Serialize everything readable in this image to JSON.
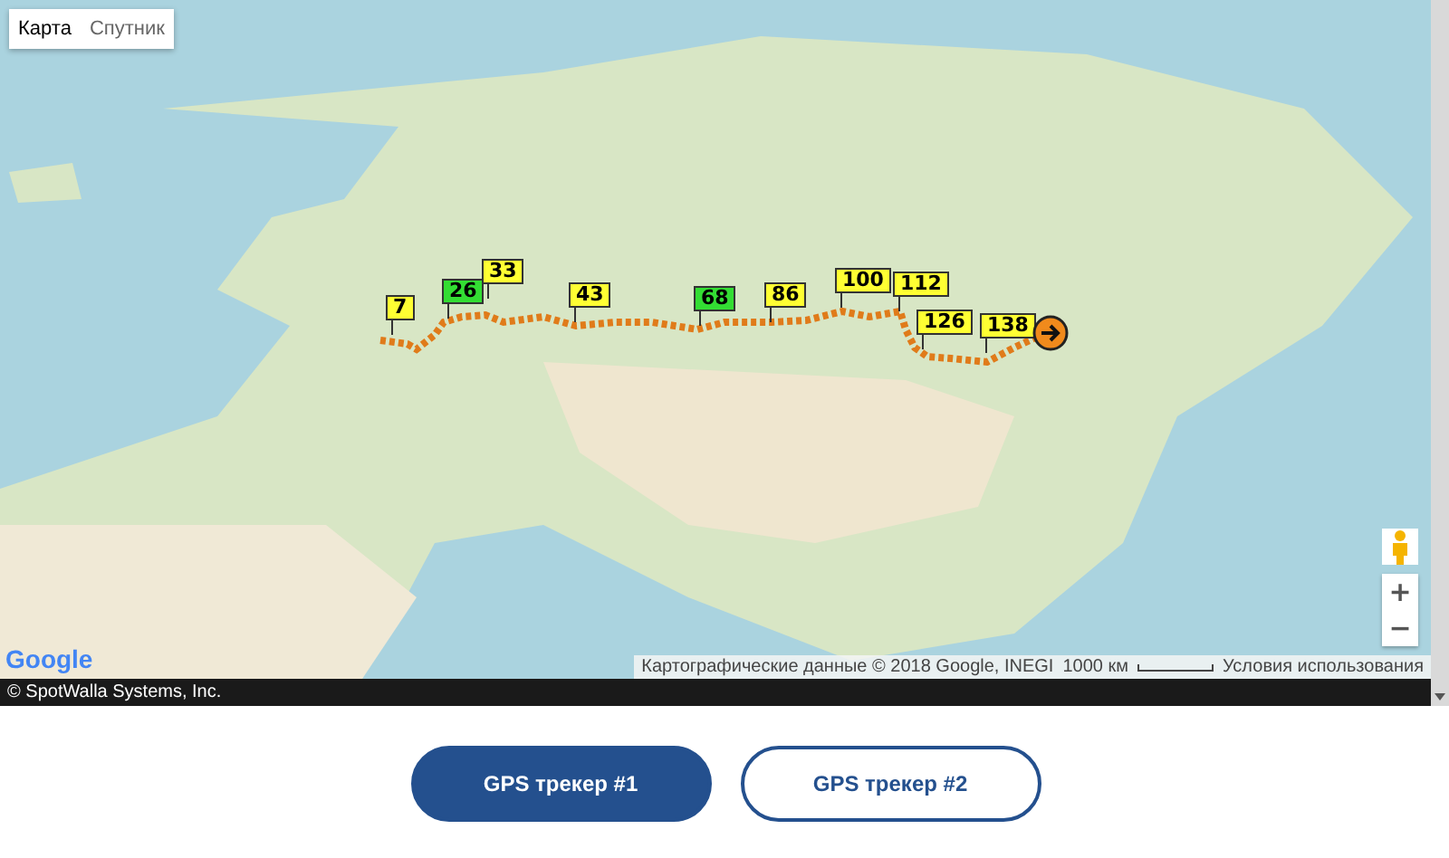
{
  "map": {
    "map_types": [
      {
        "label": "Карта",
        "selected": true
      },
      {
        "label": "Спутник",
        "selected": false
      }
    ],
    "markers": [
      {
        "label": "7",
        "color": "#ffff33"
      },
      {
        "label": "26",
        "color": "#33dd33"
      },
      {
        "label": "33",
        "color": "#ffff33"
      },
      {
        "label": "43",
        "color": "#ffff33"
      },
      {
        "label": "68",
        "color": "#33dd33"
      },
      {
        "label": "86",
        "color": "#ffff33"
      },
      {
        "label": "100",
        "color": "#ffff33"
      },
      {
        "label": "112",
        "color": "#ffff33"
      },
      {
        "label": "126",
        "color": "#ffff33"
      },
      {
        "label": "138",
        "color": "#ffff33"
      }
    ],
    "zoom_in": "+",
    "zoom_out": "−",
    "logo": "Google",
    "attribution": "Картографические данные © 2018 Google, INEGI",
    "scale": "1000 км",
    "terms": "Условия использования"
  },
  "copyright": "© SpotWalla Systems, Inc.",
  "trackers": [
    {
      "label": "GPS трекер #1",
      "selected": true
    },
    {
      "label": "GPS трекер #2",
      "selected": false
    }
  ]
}
